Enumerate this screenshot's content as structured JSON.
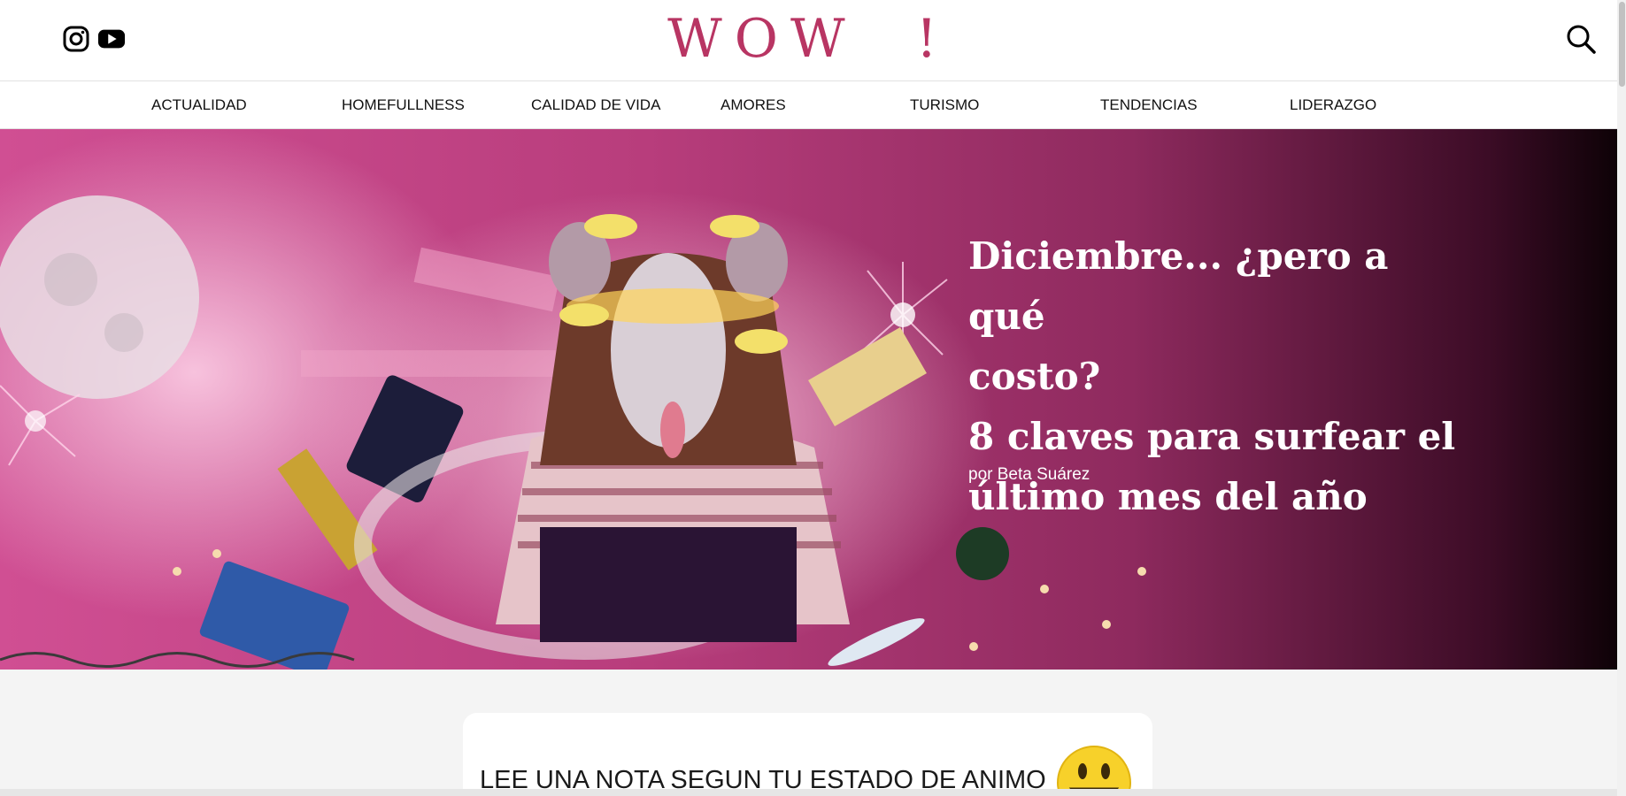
{
  "header": {
    "logo": "WOW  !",
    "social": [
      {
        "icon": "instagram-icon"
      },
      {
        "icon": "youtube-icon"
      }
    ],
    "search_icon": "search-icon"
  },
  "nav": {
    "items": [
      {
        "label": "ACTUALIDAD"
      },
      {
        "label": "HOMEFULLNESS"
      },
      {
        "label": "CALIDAD DE VIDA"
      },
      {
        "label": "AMORES"
      },
      {
        "label": "TURISMO"
      },
      {
        "label": "TENDENCIAS"
      },
      {
        "label": "LIDERAZGO"
      }
    ]
  },
  "hero": {
    "title_line1": "Diciembre... ¿pero a qué",
    "title_line2": "costo?",
    "title_line3": "8 claves para surfear el",
    "title_line4": "último mes del año",
    "author": "por Beta Suárez"
  },
  "mood": {
    "title": "LEE UNA NOTA SEGUN TU ESTADO DE ANIMO",
    "emoji_icon": "smiley-icon"
  },
  "colors": {
    "brand": "#b83563",
    "hero_pink": "#c8478a"
  }
}
